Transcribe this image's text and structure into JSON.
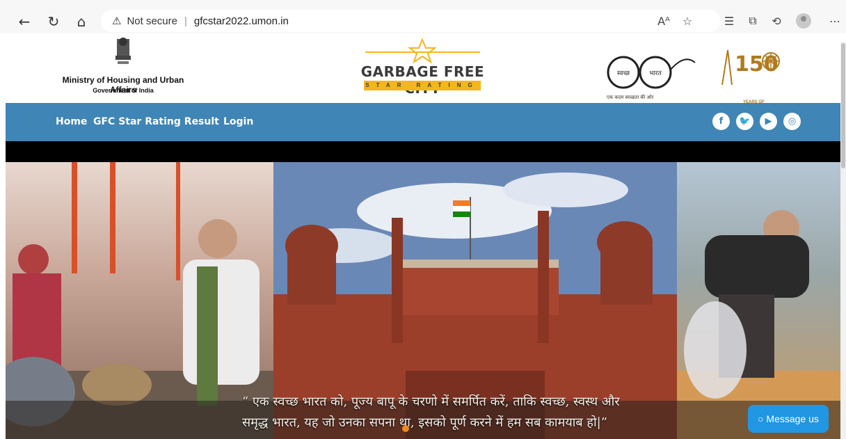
{
  "browser": {
    "warning_label": "Not secure",
    "url": "gfcstar2022.umon.in"
  },
  "header": {
    "ministry": "Ministry of Housing and Urban Affairs",
    "government": "Government of India",
    "gfc_title": "GARBAGE FREE CITY",
    "gfc_subtitle": "STAR RATING",
    "swachh_word1": "स्वच्छ",
    "swachh_word2": "भारत",
    "swachh_tagline": "एक कदम स्वच्छता की ओर",
    "years_number": "150",
    "celebrating": "YEARS OF CELEBRATING THE MAHATMA"
  },
  "nav": {
    "items": [
      {
        "label": "Home"
      },
      {
        "label": "GFC Star Rating Result"
      },
      {
        "label": "Login"
      }
    ],
    "social": [
      "facebook-icon",
      "twitter-icon",
      "youtube-icon",
      "instagram-icon"
    ]
  },
  "hero": {
    "quote_line1": "“ एक स्वच्छ भारत को, पूज्य बापू के चरणो में समर्पित करें, ताकि स्वच्छ, स्वस्थ और",
    "quote_line2": "समृद्ध भारत, यह जो उनका सपना था, इसको पूर्ण करने में हम सब कामयाब हो|”"
  },
  "chat": {
    "label": "○ Message us",
    "accent": "#2196e3"
  },
  "colors": {
    "navbar": "#3f85b6",
    "gfc_yellow": "#f3b61c"
  }
}
